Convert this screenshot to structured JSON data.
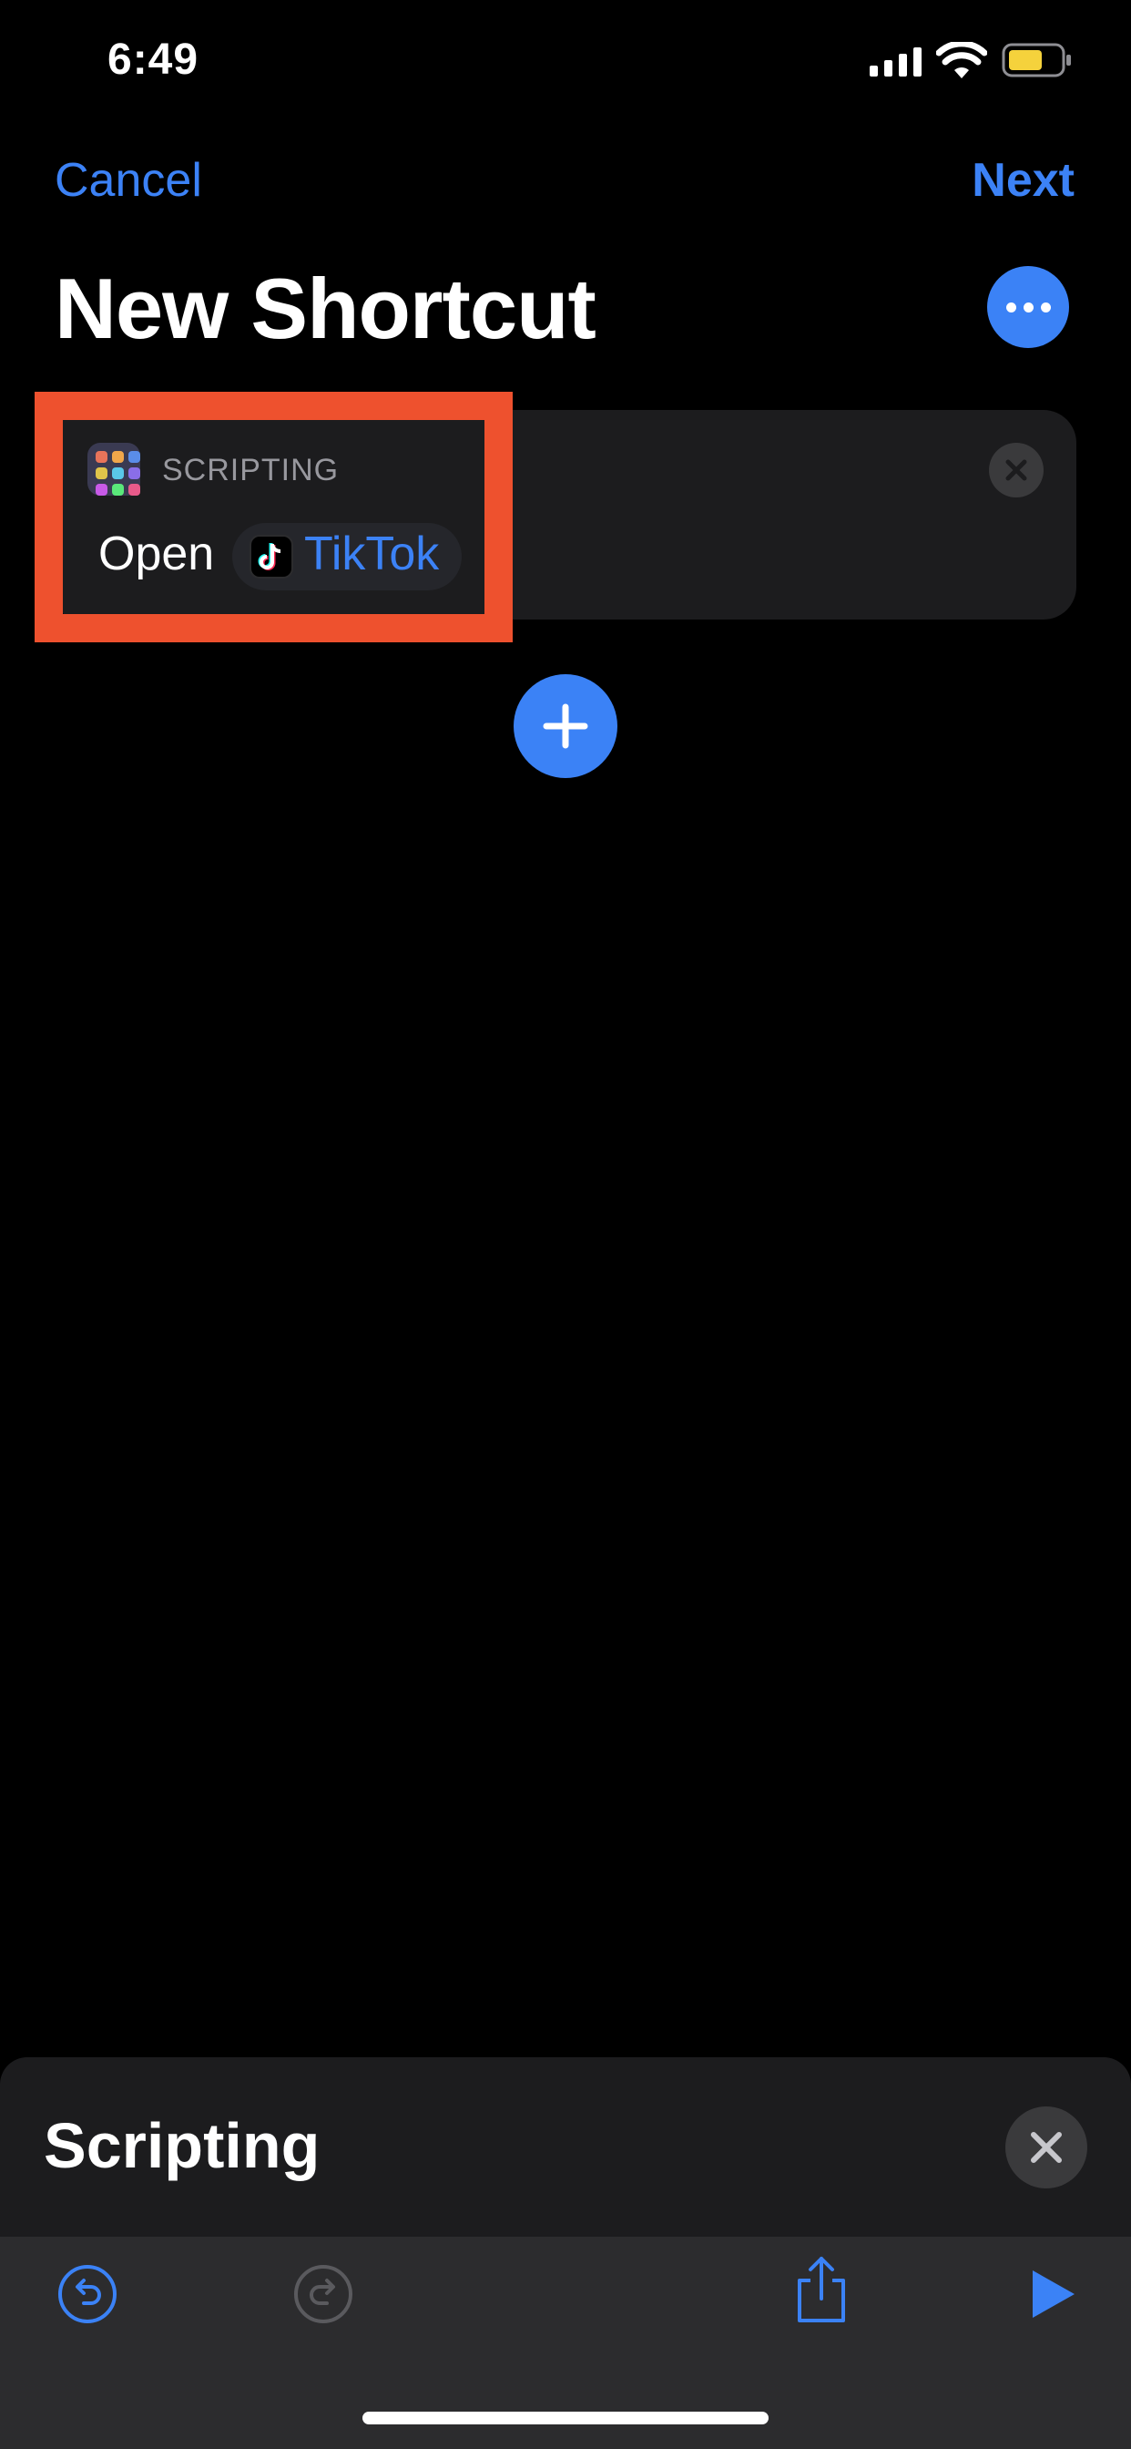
{
  "status_bar": {
    "time": "6:49"
  },
  "nav": {
    "cancel_label": "Cancel",
    "next_label": "Next"
  },
  "page": {
    "title": "New Shortcut"
  },
  "action_card": {
    "category": "SCRIPTING",
    "verb": "Open",
    "app_name": "TikTok"
  },
  "bottom_sheet": {
    "title": "Scripting"
  },
  "colors": {
    "accent": "#3b82f6",
    "highlight": "#ee512e",
    "card_background": "#1c1c1e",
    "battery": "#f5d23c"
  },
  "icons": {
    "more": "ellipsis-icon",
    "add": "plus-icon",
    "close": "close-icon",
    "undo": "undo-icon",
    "redo": "redo-icon",
    "share": "share-icon",
    "play": "play-icon"
  }
}
